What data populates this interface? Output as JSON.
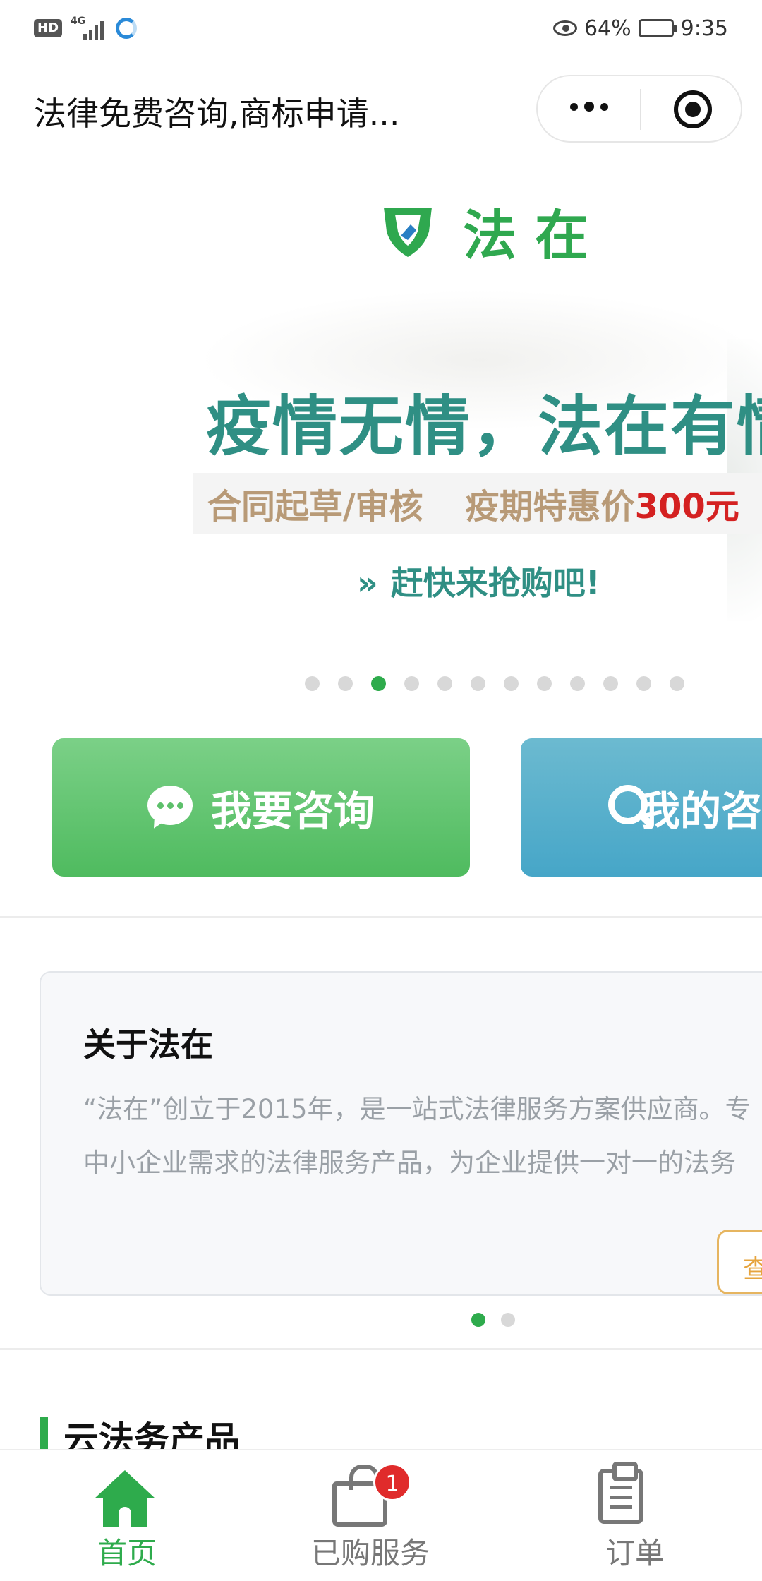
{
  "status_bar": {
    "network_badge": "HD",
    "network_type": "4G",
    "battery_percent": "64%",
    "battery_level": 0.64,
    "time": "9:35"
  },
  "header": {
    "title": "法律免费咨询,商标申请..."
  },
  "banner": {
    "brand": "法在",
    "headline": "疫情无情，法在有情",
    "service": "合同起草/审核",
    "promo_label": "疫期特惠价",
    "promo_price": "300元",
    "cta_arrow": "»",
    "cta": "赶快来抢购吧!",
    "slide_count": 12,
    "active_slide": 3
  },
  "actions": {
    "consult_label": "我要咨询",
    "query_label": "我的咨询"
  },
  "about": {
    "title": "关于法在",
    "line1": "“法在”创立于2015年，是一站式法律服务方案供应商。专",
    "line2": "中小企业需求的法律服务产品，为企业提供一对一的法务",
    "link_label": "查看"
  },
  "section": {
    "title": "云法务产品"
  },
  "tabbar": {
    "home_label": "首页",
    "purchased_label": "已购服务",
    "purchased_badge": "1",
    "orders_label": "订单"
  },
  "colors": {
    "brand_green": "#2eab4c",
    "headline_teal": "#2f8f84",
    "promo_red": "#d42121",
    "badge_red": "#e02b2b",
    "link_orange": "#e6a43e"
  }
}
